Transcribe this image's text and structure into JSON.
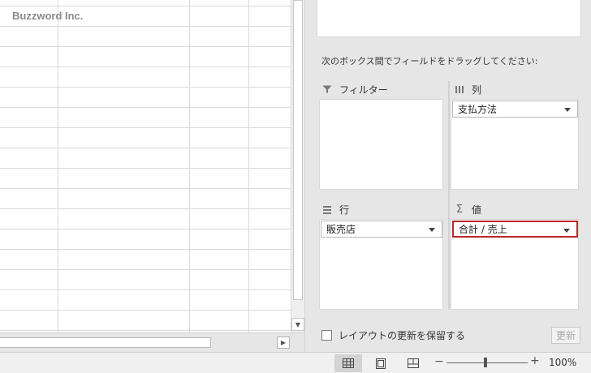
{
  "sheet": {
    "watermark": "Buzzword Inc."
  },
  "pivot_pane": {
    "instruction": "次のボックス間でフィールドをドラッグしてください:",
    "areas": {
      "filter": {
        "label": "フィルター",
        "icon": "filter-icon"
      },
      "columns": {
        "label": "列",
        "icon": "columns-icon",
        "fields": [
          "支払方法"
        ]
      },
      "rows": {
        "label": "行",
        "icon": "rows-icon",
        "fields": [
          "販売店"
        ]
      },
      "values": {
        "label": "値",
        "icon": "sigma-icon",
        "fields": [
          "合計 / 売上"
        ]
      }
    },
    "defer_label": "レイアウトの更新を保留する",
    "update_label": "更新",
    "selected_color": "#c0262b"
  },
  "statusbar": {
    "zoom_minus": "−",
    "zoom_plus": "+",
    "zoom_level": "100%"
  }
}
